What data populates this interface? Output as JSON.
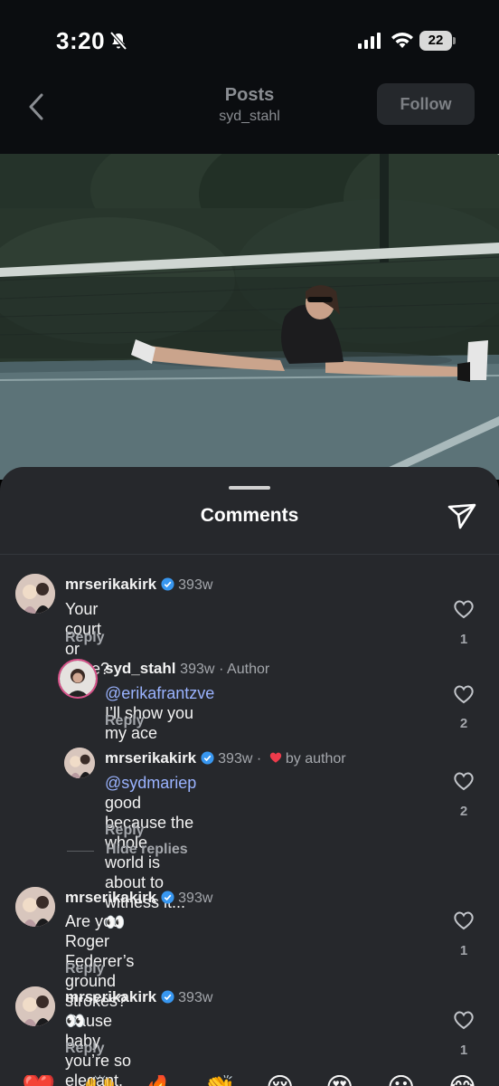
{
  "status": {
    "time": "3:20",
    "battery": "22"
  },
  "nav": {
    "title": "Posts",
    "username": "syd_stahl",
    "follow_label": "Follow"
  },
  "sheet": {
    "title": "Comments"
  },
  "comments": [
    {
      "user": "mrserikakirk",
      "verified": true,
      "age": "393w",
      "text": "Your court or mine?",
      "reply": "Reply",
      "likes": "1"
    },
    {
      "user": "syd_stahl",
      "age": "393w",
      "author_tag": "· Author",
      "mention": "@erikafrantzve",
      "text": " I’ll show you my ace",
      "reply": "Reply",
      "likes": "2"
    },
    {
      "user": "mrserikakirk",
      "verified": true,
      "age": "393w ·",
      "liked_by": "by author",
      "mention": "@sydmariep",
      "text_line1": " good because the whole",
      "text_line2": "world is about to witness it...👀",
      "reply": "Reply",
      "likes": "2"
    },
    {
      "user": "mrserikakirk",
      "verified": true,
      "age": "393w",
      "text_line1": "Are you Roger Federer’s ground strokes?",
      "text_line2": "Cause baby you’re so elegant.",
      "reply": "Reply",
      "likes": "1"
    },
    {
      "user": "mrserikakirk",
      "verified": true,
      "age": "393w",
      "text": "👀",
      "reply": "Reply",
      "likes": "1"
    }
  ],
  "hide_replies": "Hide replies",
  "reactions": [
    "❤️",
    "🙌",
    "🔥",
    "👏",
    "😢",
    "😍",
    "😮",
    "😂"
  ],
  "colors": {
    "mention": "#9ab3ff",
    "verified": "#3897f0",
    "sheet_bg": "#26282c"
  }
}
